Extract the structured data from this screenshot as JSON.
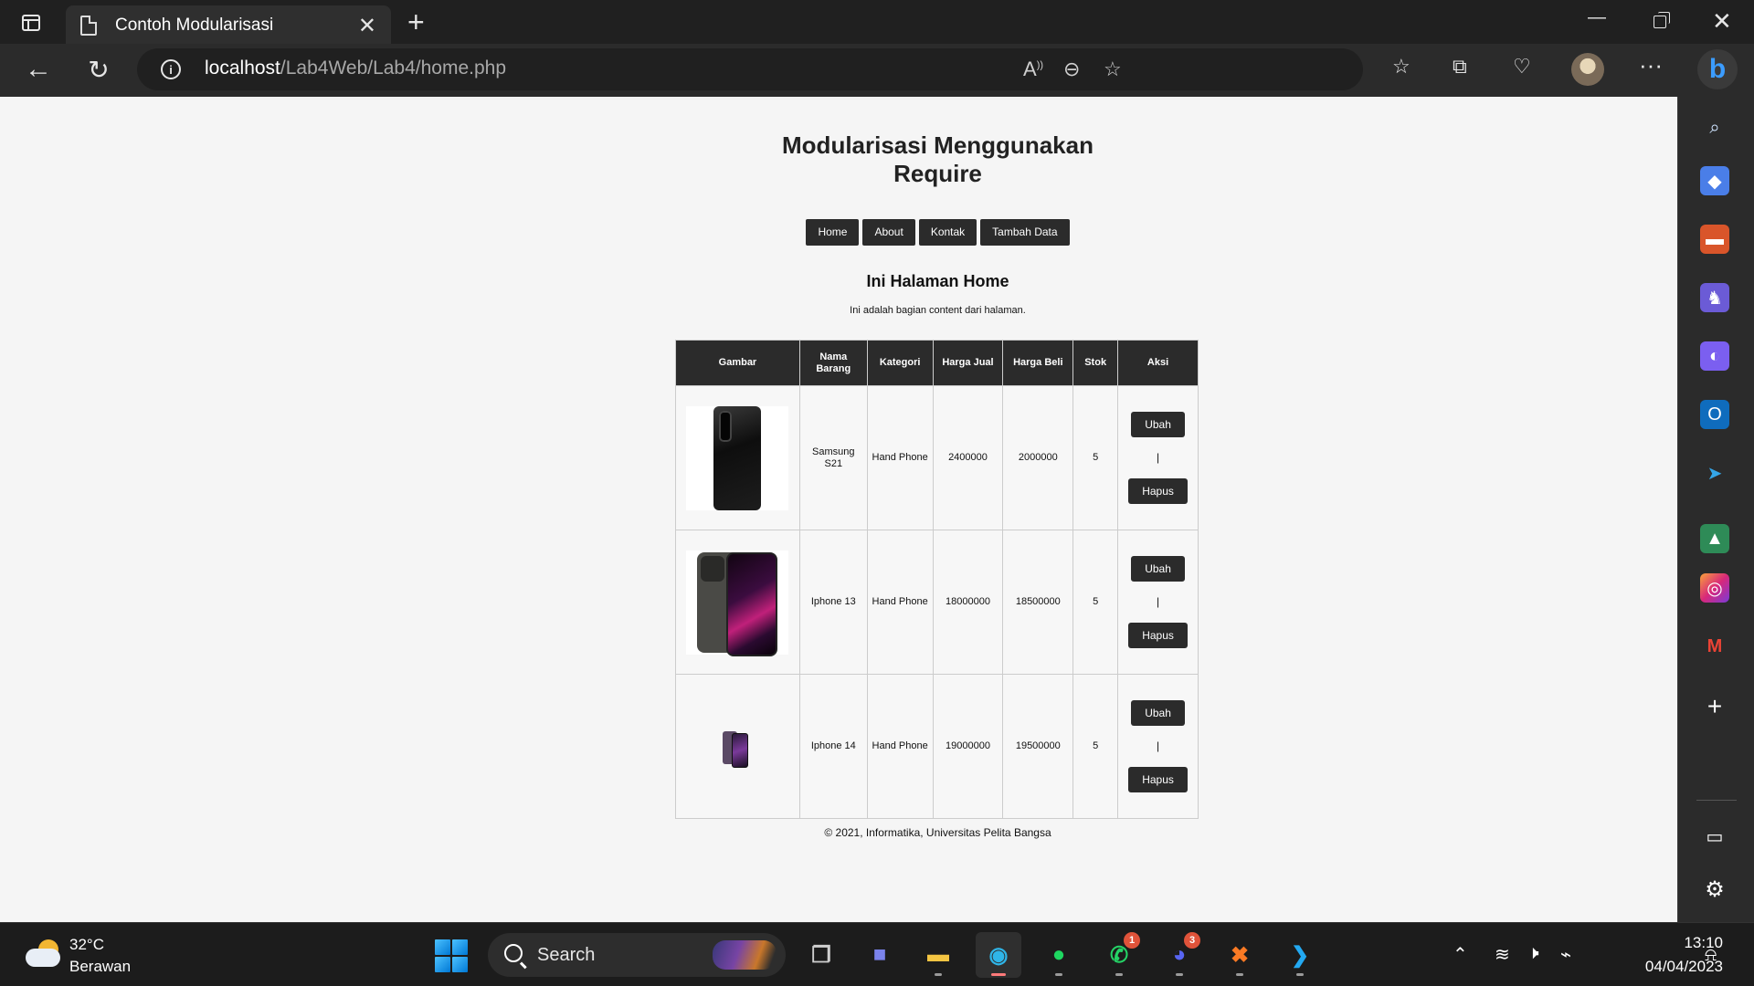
{
  "browser": {
    "tab_title": "Contoh Modularisasi",
    "tab_close": "✕",
    "new_tab": "+",
    "url_host": "localhost",
    "url_path": "/Lab4Web/Lab4/home.php",
    "toolbar_icons": [
      "read-aloud-icon",
      "zoom-out-icon",
      "add-favorite-icon",
      "favorites-icon",
      "collections-icon",
      "browser-essentials-icon",
      "profile-avatar",
      "more-options-icon",
      "bing-copilot-icon"
    ],
    "window_controls": {
      "minimize": "—",
      "close": "✕"
    }
  },
  "page": {
    "title_line1": "Modularisasi Menggunakan",
    "title_line2": "Require",
    "menu": [
      {
        "label": "Home"
      },
      {
        "label": "About"
      },
      {
        "label": "Kontak"
      },
      {
        "label": "Tambah Data"
      }
    ],
    "content_title": "Ini Halaman Home",
    "content_text": "Ini adalah bagian content dari halaman.",
    "table": {
      "headers": [
        "Gambar",
        "Nama Barang",
        "Kategori",
        "Harga Jual",
        "Harga Beli",
        "Stok",
        "Aksi"
      ],
      "rows": [
        {
          "image": "samsung-s21-image",
          "nama": "Samsung S21",
          "kategori": "Hand Phone",
          "harga_jual": "2400000",
          "harga_beli": "2000000",
          "stok": "5",
          "ubah": "Ubah",
          "sep": "|",
          "hapus": "Hapus"
        },
        {
          "image": "iphone-13-image",
          "nama": "Iphone 13",
          "kategori": "Hand Phone",
          "harga_jual": "18000000",
          "harga_beli": "18500000",
          "stok": "5",
          "ubah": "Ubah",
          "sep": "|",
          "hapus": "Hapus"
        },
        {
          "image": "iphone-14-image",
          "nama": "Iphone 14",
          "kategori": "Hand Phone",
          "harga_jual": "19000000",
          "harga_beli": "19500000",
          "stok": "5",
          "ubah": "Ubah",
          "sep": "|",
          "hapus": "Hapus"
        }
      ]
    },
    "footer": "© 2021, Informatika, Universitas Pelita Bangsa"
  },
  "sidebar": {
    "items": [
      "search-icon",
      "shopping-icon",
      "tools-icon",
      "games-icon",
      "microsoft-365-icon",
      "outlook-icon",
      "telegram-icon",
      "sidebar-app-icon",
      "instagram-icon",
      "gmail-icon",
      "add-icon",
      "split-screen-icon",
      "settings-icon"
    ]
  },
  "taskbar": {
    "weather_temp": "32°C",
    "weather_desc": "Berawan",
    "search_label": "Search",
    "apps": [
      {
        "name": "task-view-icon"
      },
      {
        "name": "teams-icon"
      },
      {
        "name": "file-explorer-icon"
      },
      {
        "name": "edge-icon",
        "active": true
      },
      {
        "name": "spotify-icon"
      },
      {
        "name": "whatsapp-icon",
        "badge": "1"
      },
      {
        "name": "discord-icon",
        "badge": "3"
      },
      {
        "name": "xampp-icon"
      },
      {
        "name": "vscode-icon"
      }
    ],
    "clock_time": "13:10",
    "clock_date": "04/04/2023"
  },
  "colors": {
    "browser_bg": "#202020",
    "page_bg": "#f5f5f5",
    "header_dark": "#2b2b2b",
    "accent_blue": "#3b9cff"
  }
}
